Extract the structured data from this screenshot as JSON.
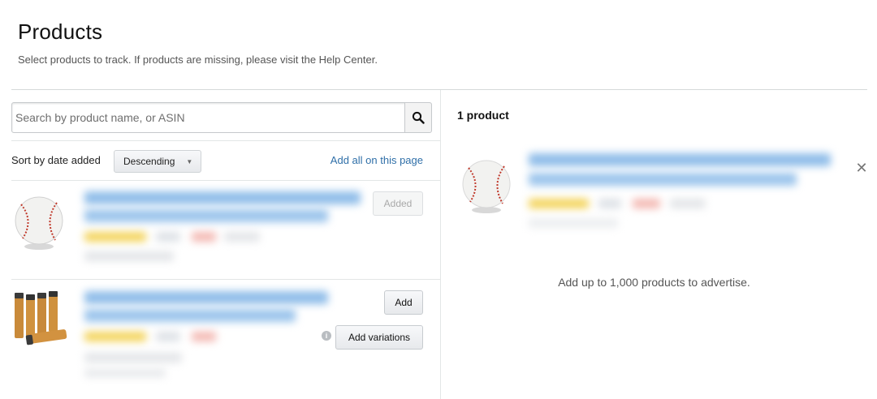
{
  "header": {
    "title": "Products",
    "subtitle": "Select products to track. If products are missing, please visit the Help Center."
  },
  "search": {
    "placeholder": "Search by product name, or ASIN",
    "button_icon": "search-icon"
  },
  "sort": {
    "label": "Sort by date added",
    "selected": "Descending",
    "add_all_label": "Add all on this page"
  },
  "results": [
    {
      "thumbnail": "baseball-icon",
      "button_label": "Added",
      "button_state": "disabled"
    },
    {
      "thumbnail": "batteries-icon",
      "button_label": "Add",
      "secondary_button_label": "Add variations",
      "info_icon": "info-icon"
    }
  ],
  "selected_panel": {
    "count_label": "1 product",
    "items": [
      {
        "thumbnail": "baseball-icon",
        "remove_icon": "close-icon"
      }
    ],
    "limit_message": "Add up to 1,000 products to advertise."
  },
  "colors": {
    "link": "#2f6fa8",
    "divider": "#e3e6e6",
    "blurred_text": "#7fb2e5",
    "rating_stars": "#f3d35a",
    "price_highlight": "#f3b8b2"
  }
}
